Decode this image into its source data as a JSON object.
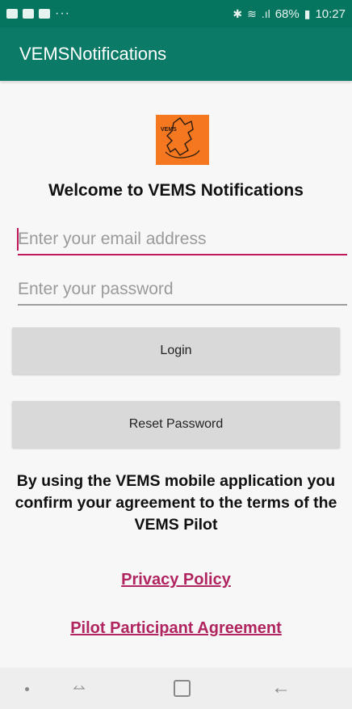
{
  "status_bar": {
    "left_dots": "···",
    "bluetooth": "✱",
    "wifi": "≋",
    "signal": ".ıl",
    "battery_text": "68%",
    "battery_icon": "▮",
    "time": "10:27"
  },
  "app_bar": {
    "title": "VEMSNotifications"
  },
  "logo": {
    "icon": "fox-logo-icon",
    "text": "VEMS"
  },
  "welcome": "Welcome to VEMS Notifications",
  "email": {
    "placeholder": "Enter your email address",
    "value": ""
  },
  "password": {
    "placeholder": "Enter your password",
    "value": ""
  },
  "buttons": {
    "login": "Login",
    "reset": "Reset Password"
  },
  "terms": "By using the VEMS mobile application you confirm your agreement to the terms of the VEMS Pilot",
  "links": {
    "privacy": "Privacy Policy",
    "agreement": "Pilot Participant Agreement"
  },
  "nav": {
    "recent": "⥎",
    "back": "←"
  },
  "colors": {
    "status_bar": "#06755f",
    "app_bar": "#0b7a66",
    "accent": "#c2185b",
    "link": "#b0245f",
    "logo_bg": "#f57820"
  }
}
